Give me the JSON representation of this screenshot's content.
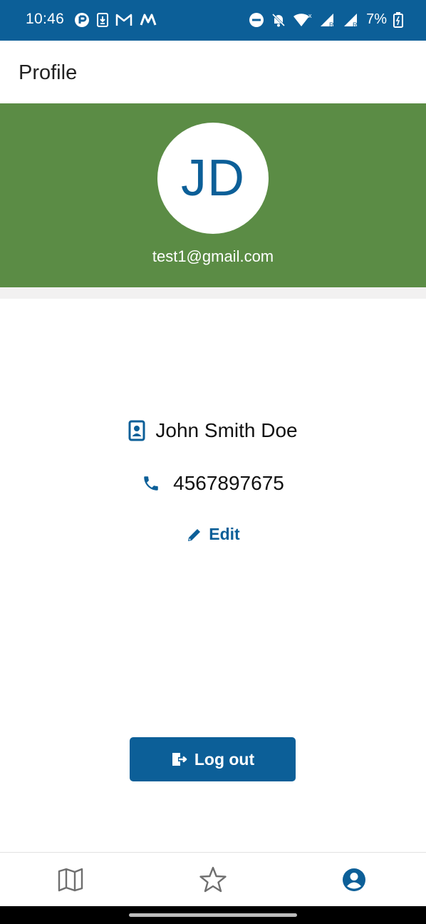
{
  "colors": {
    "primary": "#0c5f98",
    "header_green": "#5b8c45",
    "inactive_icon": "#6f6f6f"
  },
  "status_bar": {
    "time": "10:46",
    "battery": "7%",
    "left_icons": [
      "clock-app-icon",
      "download-icon",
      "gmail-icon",
      "m-app-icon"
    ],
    "right_icons": [
      "do-not-disturb-icon",
      "bell-off-icon",
      "wifi-icon",
      "signal-icon",
      "signal-icon",
      "battery-icon"
    ]
  },
  "app_bar": {
    "title": "Profile"
  },
  "profile": {
    "initials": "JD",
    "email": "test1@gmail.com",
    "full_name": "John Smith Doe",
    "phone": "4567897675",
    "edit_label": "Edit"
  },
  "logout": {
    "label": "Log out"
  },
  "bottom_nav": {
    "items": [
      {
        "icon": "map-icon",
        "active": false
      },
      {
        "icon": "star-icon",
        "active": false
      },
      {
        "icon": "account-icon",
        "active": true
      }
    ]
  }
}
